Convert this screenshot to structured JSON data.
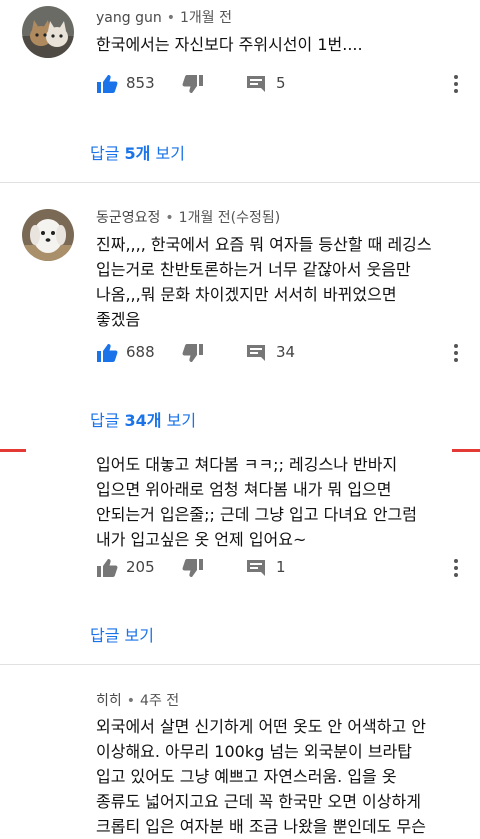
{
  "comments": [
    {
      "author": "yang gun",
      "time": "1개월 전",
      "text": "한국에서는 자신보다 주위시선이 1번....",
      "likes": "853",
      "replies_count": "5",
      "reply_link_prefix": "답글 ",
      "reply_link_count": "5개",
      "reply_link_suffix": " 보기"
    },
    {
      "author": "동군영요정",
      "time": "1개월 전(수정됨)",
      "text": "진짜,,,, 한국에서 요즘 뭐 여자들 등산할 때 레깅스\n입는거로 찬반토론하는거 너무 같잖아서 웃음만\n나옴,,,뭐 문화 차이겠지만 서서히 바뀌었으면\n좋겠음",
      "likes": "688",
      "replies_count": "34",
      "reply_link_prefix": "답글 ",
      "reply_link_count": "34개",
      "reply_link_suffix": " 보기"
    },
    {
      "text": "입어도 대놓고 쳐다봄 ㅋㅋ;; 레깅스나 반바지\n입으면 위아래로 엄청 쳐다봄  내가 뭐 입으면\n안되는거 입은줄;; 근데 그냥 입고 다녀요 안그럼\n내가 입고싶은 옷 언제 입어요~",
      "likes": "205",
      "replies_count": "1",
      "reply_link_text": "답글 보기"
    },
    {
      "author": "히히",
      "time": "4주 전",
      "text": "외국에서 살면 신기하게 어떤 옷도 안 어색하고 안\n이상해요. 아무리 100kg 넘는 외국분이 브라탑\n입고 있어도 그냥 예쁘고 자연스러움. 입을 옷\n종류도 넓어지고요 근데 꼭 한국만 오면 이상하게\n크롭티 입은 여자분 배 조금 나왔을 뿐인데도 무슨"
    }
  ],
  "separator": "•",
  "colors": {
    "link": "#1a73e8",
    "divider": "#e1e1e1",
    "accent_red": "#e53935"
  }
}
